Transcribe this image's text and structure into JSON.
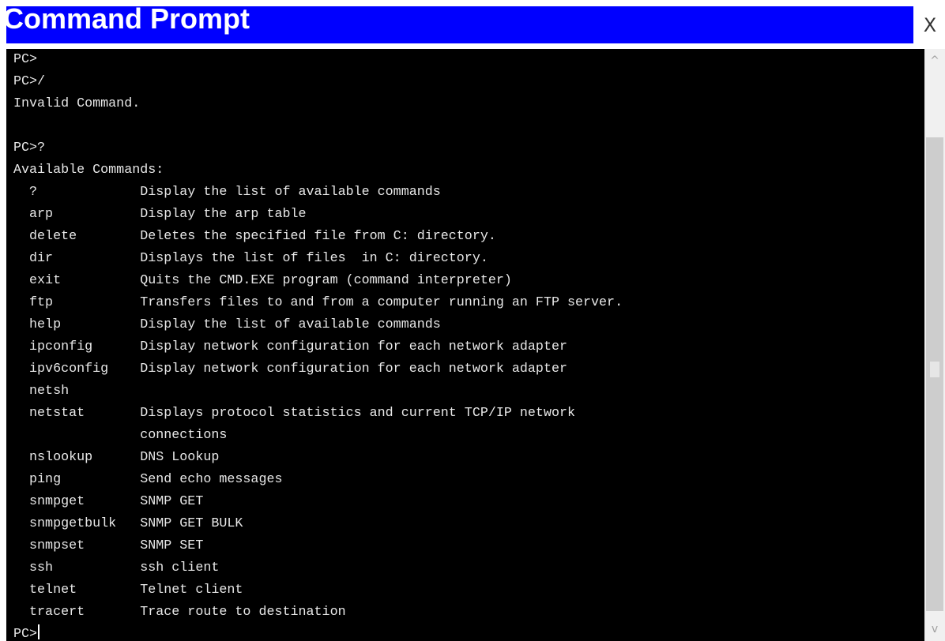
{
  "window": {
    "title": "Command Prompt",
    "close_label": "X"
  },
  "scrollbar": {
    "up_glyph": "^",
    "down_glyph": "v"
  },
  "terminal": {
    "lines": [
      "PC>",
      "PC>/",
      "Invalid Command.",
      "",
      "PC>?",
      "Available Commands:",
      "  ?             Display the list of available commands",
      "  arp           Display the arp table",
      "  delete        Deletes the specified file from C: directory.",
      "  dir           Displays the list of files  in C: directory.",
      "  exit          Quits the CMD.EXE program (command interpreter)",
      "  ftp           Transfers files to and from a computer running an FTP server.",
      "  help          Display the list of available commands",
      "  ipconfig      Display network configuration for each network adapter",
      "  ipv6config    Display network configuration for each network adapter",
      "  netsh",
      "  netstat       Displays protocol statistics and current TCP/IP network",
      "                connections",
      "  nslookup      DNS Lookup",
      "  ping          Send echo messages",
      "  snmpget       SNMP GET",
      "  snmpgetbulk   SNMP GET BULK",
      "  snmpset       SNMP SET",
      "  ssh           ssh client",
      "  telnet        Telnet client",
      "  tracert       Trace route to destination"
    ],
    "prompt": "PC>"
  }
}
